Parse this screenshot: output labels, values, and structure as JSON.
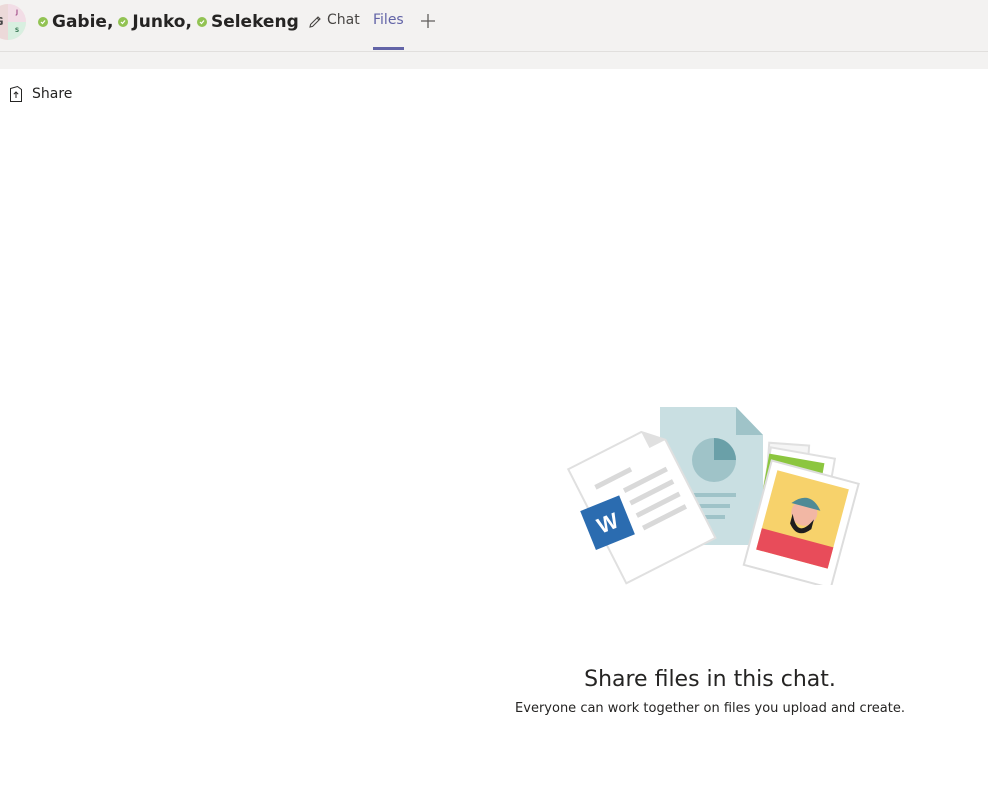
{
  "header": {
    "avatar_initials": [
      "G",
      "J",
      "S"
    ],
    "participants": [
      {
        "name": "Gabie,",
        "status": "available"
      },
      {
        "name": "Junko,",
        "status": "available"
      },
      {
        "name": "Selekeng",
        "status": "available"
      }
    ],
    "edit_icon": "pencil-icon",
    "tabs": [
      {
        "label": "Chat",
        "active": false
      },
      {
        "label": "Files",
        "active": true
      }
    ],
    "add_tab_icon": "plus-icon"
  },
  "toolbar": {
    "share_label": "Share",
    "share_icon": "share-upload-icon"
  },
  "empty_state": {
    "title": "Share files in this chat.",
    "subtitle": "Everyone can work together on files you upload and create.",
    "illustration": "files-illustration"
  },
  "colors": {
    "accent": "#6264a7",
    "presence_available": "#92c353",
    "header_bg": "#f3f2f1"
  }
}
